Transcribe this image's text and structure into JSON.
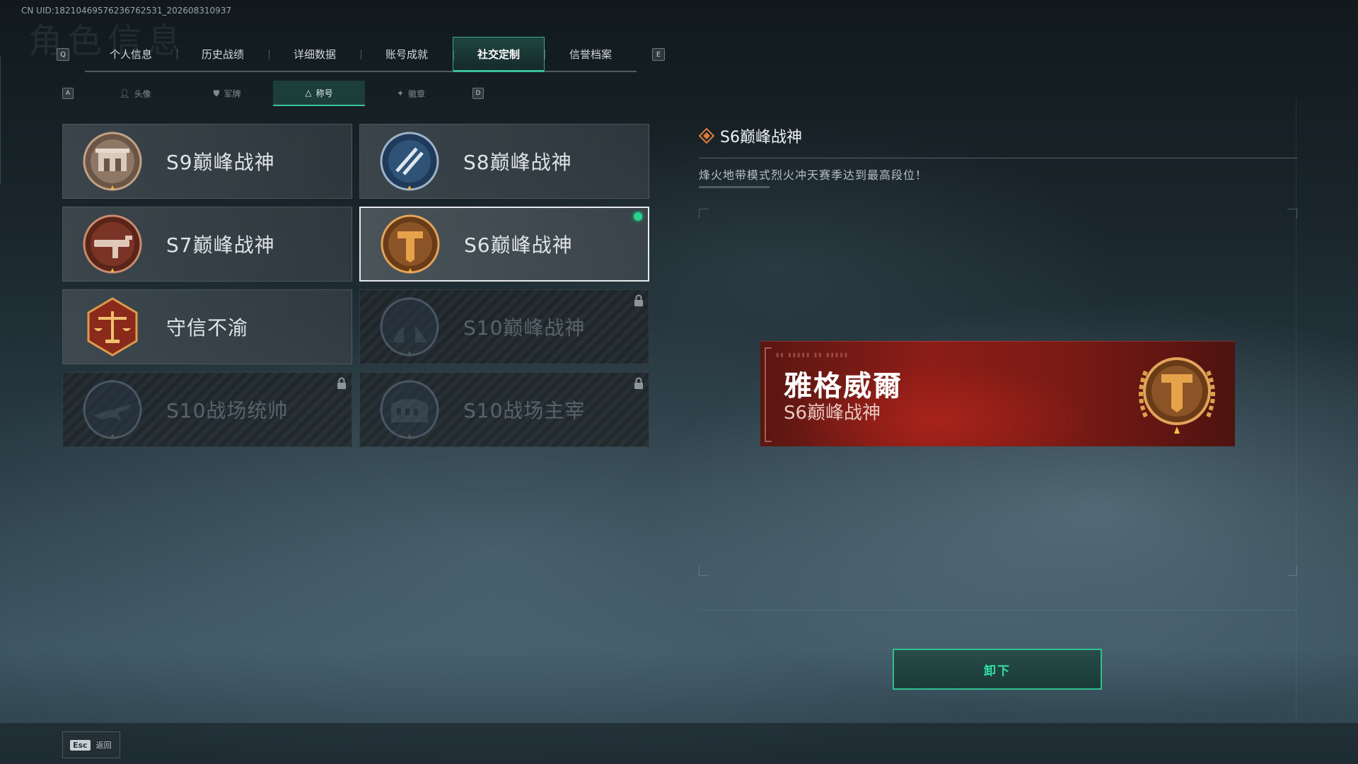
{
  "uid": "CN UID:18210469576236762531_202608310937",
  "bg_title": "角色信息",
  "top_tabs": {
    "left_key": "Q",
    "right_key": "E",
    "items": [
      {
        "label": "个人信息"
      },
      {
        "label": "历史战绩"
      },
      {
        "label": "详细数据"
      },
      {
        "label": "账号成就"
      },
      {
        "label": "社交定制"
      },
      {
        "label": "信誉档案"
      }
    ],
    "active_index": 4
  },
  "sub_tabs": {
    "left_key": "A",
    "right_key": "D",
    "items": [
      {
        "label": "头像",
        "icon": "person-icon"
      },
      {
        "label": "军牌",
        "icon": "dogtag-icon"
      },
      {
        "label": "称号",
        "icon": "triangle-title-icon"
      },
      {
        "label": "徽章",
        "icon": "medal-icon"
      }
    ],
    "active_index": 2
  },
  "titles": [
    {
      "label": "S9巅峰战神",
      "badge": "gate-badge-icon",
      "state": "normal"
    },
    {
      "label": "S8巅峰战神",
      "badge": "striped-shield-badge-icon",
      "state": "normal"
    },
    {
      "label": "S7巅峰战神",
      "badge": "rifle-badge-icon",
      "state": "normal"
    },
    {
      "label": "S6巅峰战神",
      "badge": "t-emblem-badge-icon",
      "state": "selected"
    },
    {
      "label": "守信不渝",
      "badge": "scales-badge-icon",
      "state": "normal"
    },
    {
      "label": "S10巅峰战神",
      "badge": "monument-badge-icon",
      "state": "locked"
    },
    {
      "label": "S10战场统帅",
      "badge": "jet-badge-icon",
      "state": "locked"
    },
    {
      "label": "S10战场主宰",
      "badge": "colosseum-badge-icon",
      "state": "locked"
    }
  ],
  "detail": {
    "title": "S6巅峰战神",
    "description": "烽火地带模式烈火冲天赛季达到最高段位！"
  },
  "banner": {
    "player_name": "雅格威爾",
    "title": "S6巅峰战神"
  },
  "actions": {
    "unequip_label": "卸下",
    "esc_key": "Esc",
    "back_label": "返回"
  },
  "colors": {
    "accent_green": "#39c29b",
    "banner_red": "#8c1d17",
    "gold": "#c98a3a"
  }
}
